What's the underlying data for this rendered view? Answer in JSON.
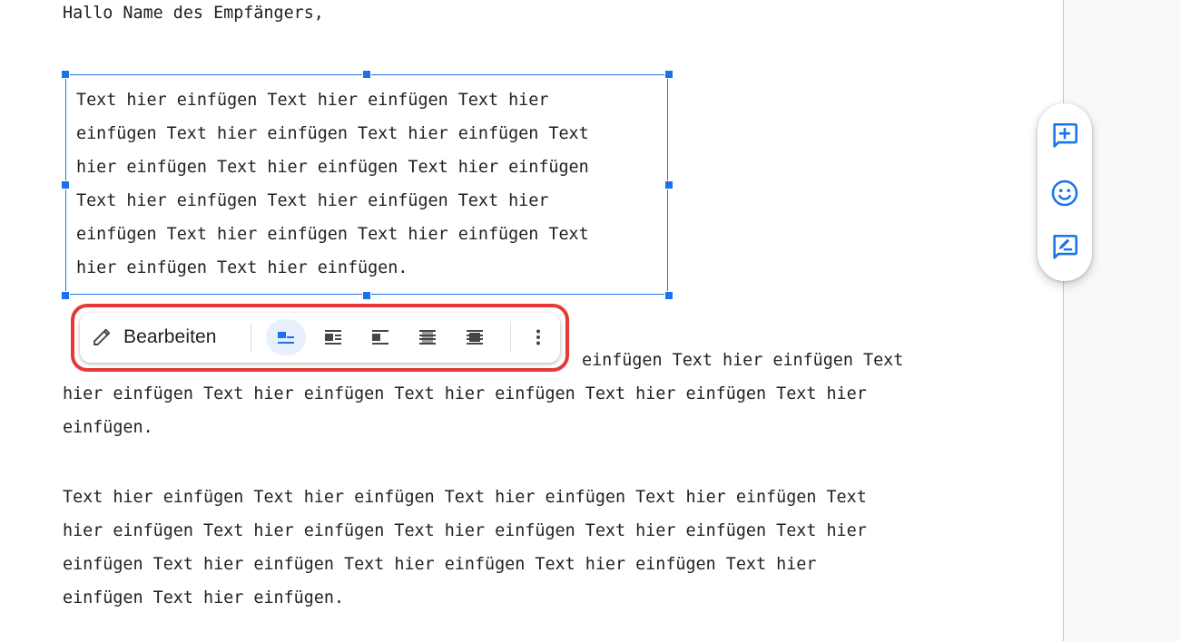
{
  "document": {
    "greeting": "Hallo Name des Empfängers,",
    "textbox_text": "Text hier einfügen Text hier einfügen Text hier\neinfügen Text hier einfügen Text hier einfügen Text\nhier einfügen Text hier einfügen Text hier einfügen\nText hier einfügen Text hier einfügen Text hier\neinfügen Text hier einfügen Text hier einfügen Text\nhier einfügen Text hier einfügen.",
    "paragraph1_visible_end": "einfügen Text hier einfügen Text",
    "paragraph1_rest": "hier einfügen Text hier einfügen Text hier einfügen Text hier einfügen Text hier\neinfügen.",
    "paragraph2": "Text hier einfügen Text hier einfügen Text hier einfügen Text hier einfügen Text\nhier einfügen Text hier einfügen Text hier einfügen Text hier einfügen Text hier\neinfügen Text hier einfügen Text hier einfügen Text hier einfügen Text hier\neinfügen Text hier einfügen."
  },
  "image_toolbar": {
    "edit_label": "Bearbeiten",
    "edit_icon": "pencil-icon",
    "wrap_options": [
      {
        "name": "in-line",
        "icon": "wrap-inline-icon",
        "active": true
      },
      {
        "name": "wrap-text",
        "icon": "wrap-text-icon",
        "active": false
      },
      {
        "name": "break-text",
        "icon": "break-text-icon",
        "active": false
      },
      {
        "name": "behind-text",
        "icon": "behind-text-icon",
        "active": false
      },
      {
        "name": "in-front-of-text",
        "icon": "in-front-of-text-icon",
        "active": false
      }
    ],
    "more_icon": "more-vert-icon",
    "highlight_color": "#e53935"
  },
  "side_actions": [
    {
      "name": "add-comment",
      "icon": "add-comment-icon"
    },
    {
      "name": "add-emoji-reaction",
      "icon": "emoji-icon"
    },
    {
      "name": "suggest-edits",
      "icon": "suggest-edits-icon"
    }
  ],
  "colors": {
    "accent": "#1a73e8",
    "text": "#202124",
    "icon": "#444746"
  }
}
